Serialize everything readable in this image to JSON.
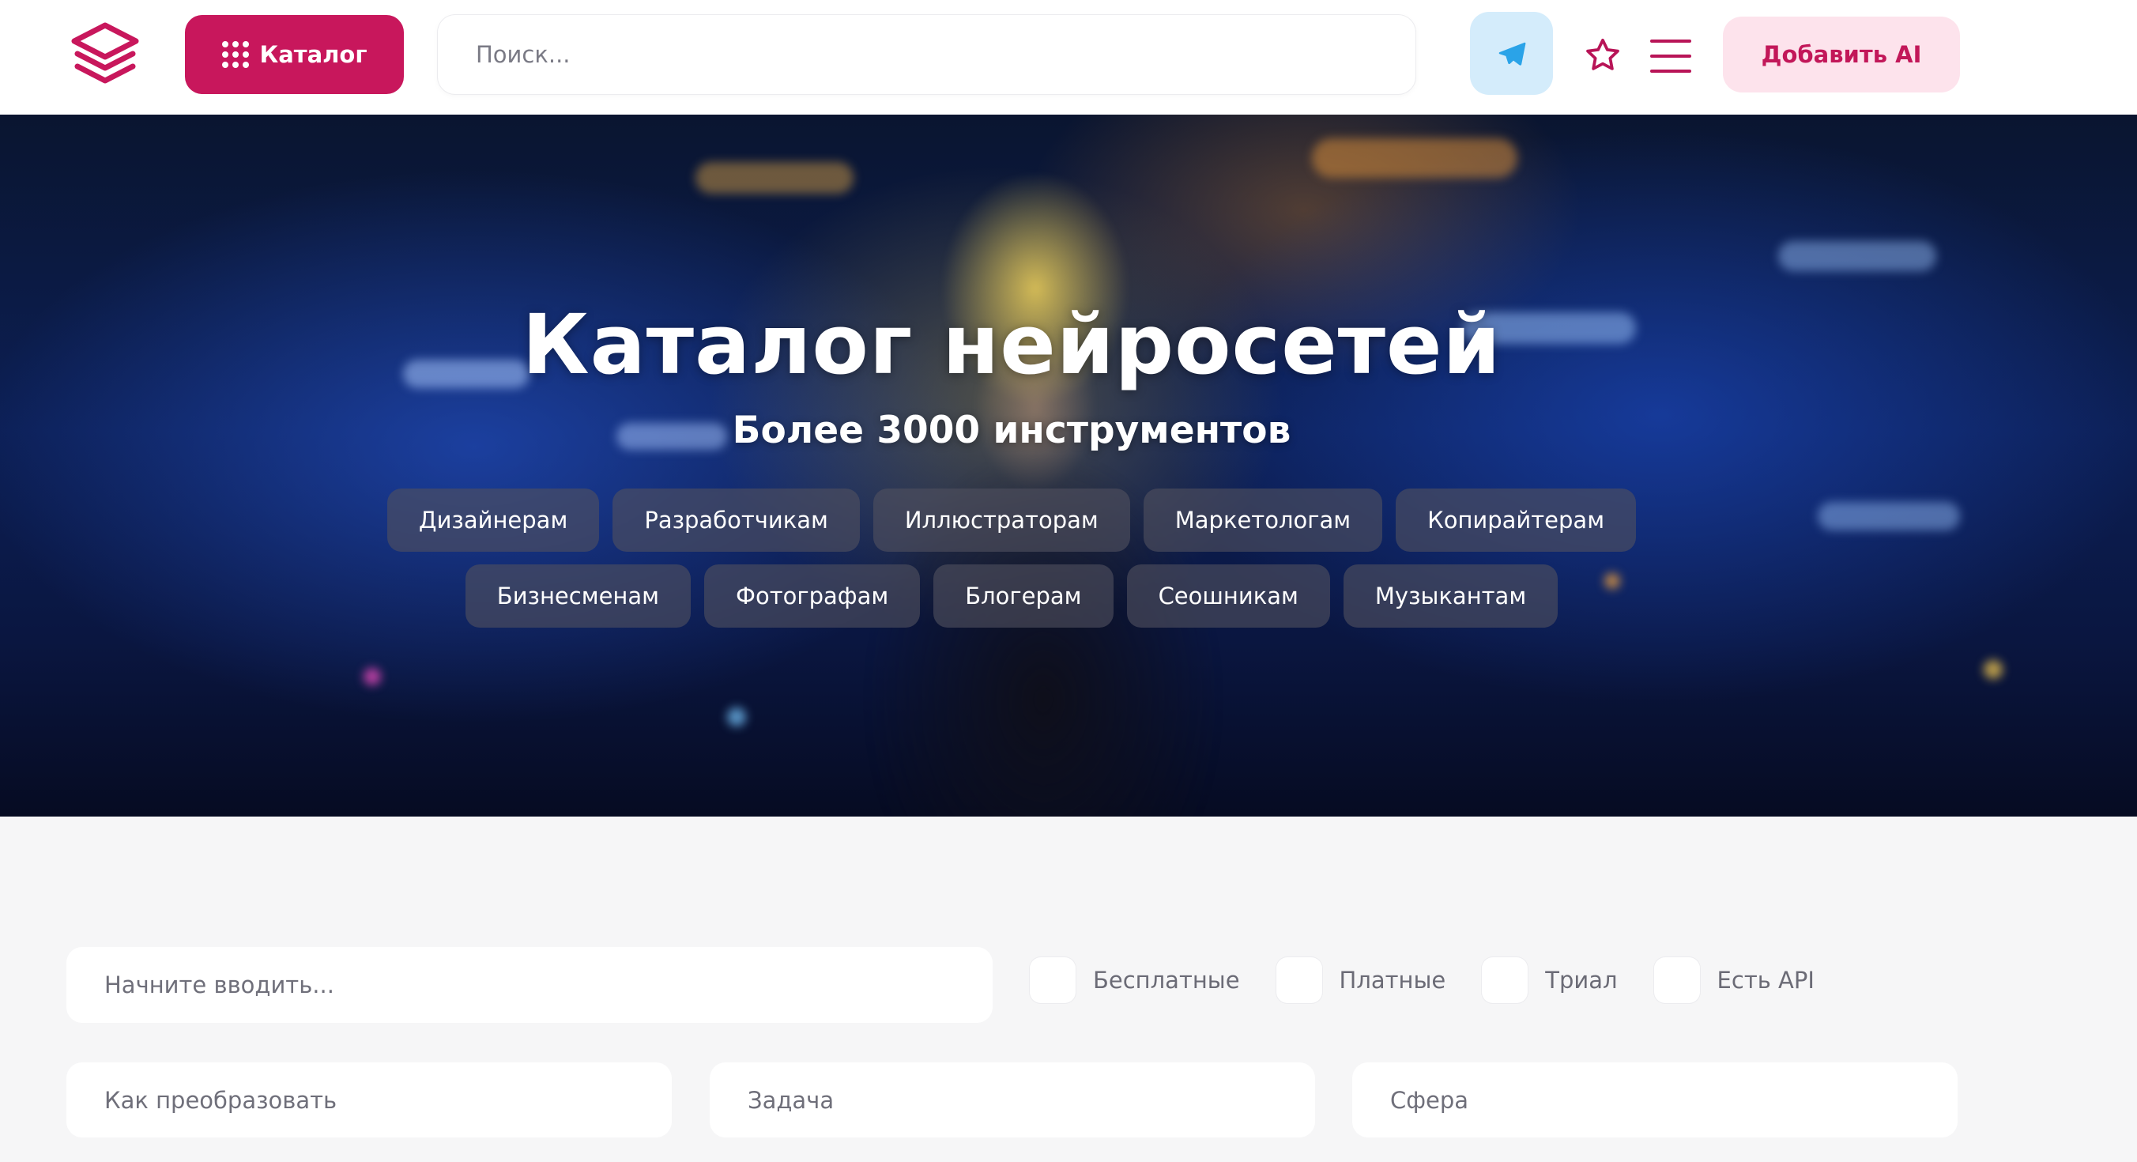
{
  "header": {
    "catalog_label": "Каталог",
    "search_placeholder": "Поиск...",
    "add_label": "Добавить AI"
  },
  "hero": {
    "title": "Каталог нейросетей",
    "subtitle": "Более 3000 инструментов",
    "tags_row1": [
      "Дизайнерам",
      "Разработчикам",
      "Иллюстраторам",
      "Маркетологам",
      "Копирайтерам"
    ],
    "tags_row2": [
      "Бизнесменам",
      "Фотографам",
      "Блогерам",
      "Сеошникам",
      "Музыкантам"
    ]
  },
  "filters": {
    "search_placeholder": "Начните вводить...",
    "checkboxes": [
      "Бесплатные",
      "Платные",
      "Триал",
      "Есть API"
    ],
    "selects": [
      "Как преобразовать",
      "Задача",
      "Сфера"
    ]
  },
  "colors": {
    "brand": "#c8175c",
    "telegram_bg": "#d4ecfb",
    "add_bg": "#fde3ec"
  }
}
